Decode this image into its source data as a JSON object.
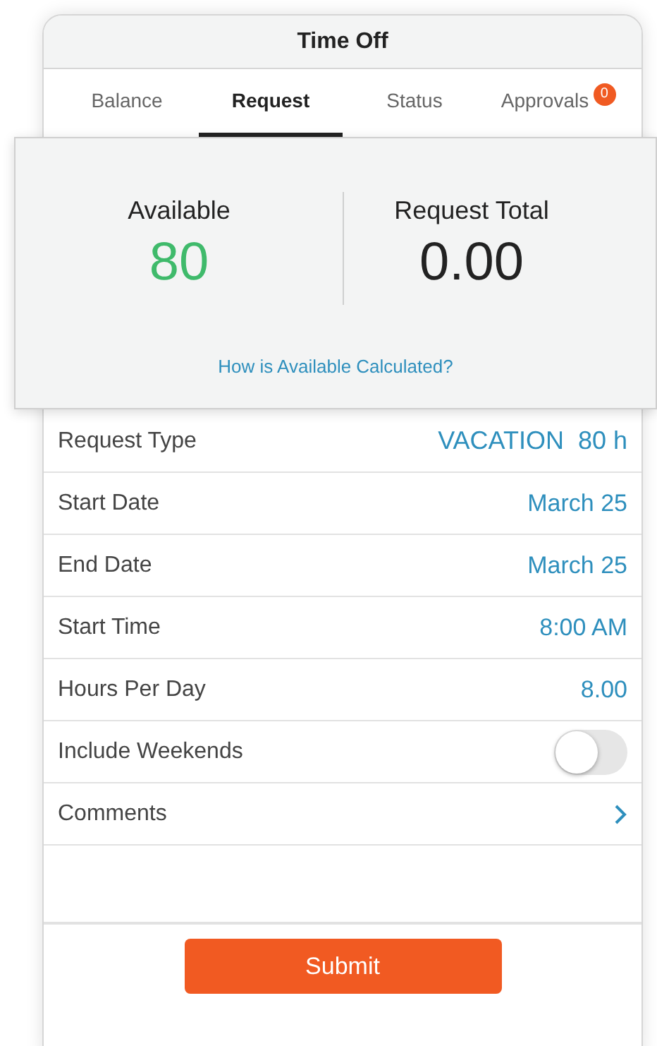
{
  "window": {
    "title": "Time Off"
  },
  "tabs": [
    {
      "label": "Balance",
      "selected": false
    },
    {
      "label": "Request",
      "selected": true
    },
    {
      "label": "Status",
      "selected": false
    },
    {
      "label": "Approvals",
      "selected": false,
      "badge": "0"
    }
  ],
  "summary": {
    "available_label": "Available",
    "available_value": "80",
    "total_label": "Request Total",
    "total_value": "0.00",
    "link": "How is Available Calculated?"
  },
  "rows": [
    {
      "kind": "value",
      "label": "Request Type",
      "value": "VACATION",
      "extra": "80 h"
    },
    {
      "kind": "value",
      "label": "Start Date",
      "value": "March 25"
    },
    {
      "kind": "value",
      "label": "End Date",
      "value": "March 25"
    },
    {
      "kind": "value",
      "label": "Start Time",
      "value": "8:00 AM"
    },
    {
      "kind": "value",
      "label": "Hours Per Day",
      "value": "8.00"
    },
    {
      "kind": "toggle",
      "label": "Include Weekends",
      "on": false
    },
    {
      "kind": "link",
      "label": "Comments"
    }
  ],
  "submit": "Submit"
}
